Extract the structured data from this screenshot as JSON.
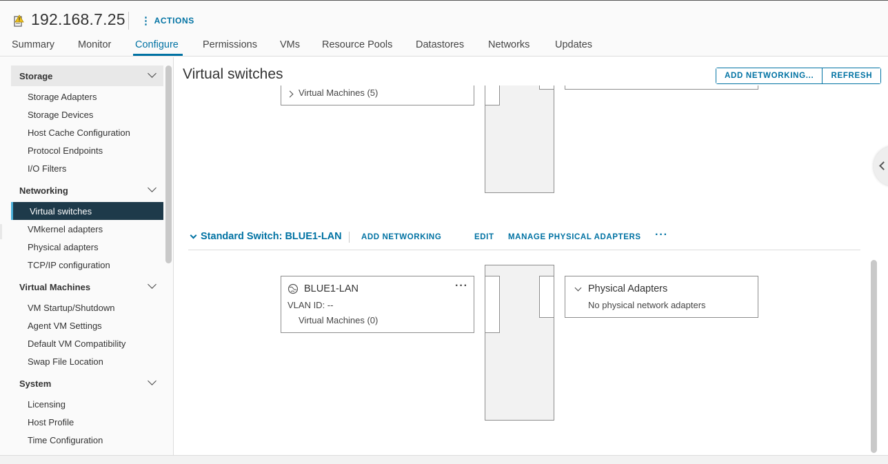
{
  "header": {
    "host_title": "192.168.7.25",
    "actions_label": "ACTIONS"
  },
  "tabs": [
    {
      "label": "Summary"
    },
    {
      "label": "Monitor"
    },
    {
      "label": "Configure",
      "active": true
    },
    {
      "label": "Permissions"
    },
    {
      "label": "VMs"
    },
    {
      "label": "Resource Pools"
    },
    {
      "label": "Datastores"
    },
    {
      "label": "Networks"
    },
    {
      "label": "Updates"
    }
  ],
  "sidebar": {
    "storage": {
      "title": "Storage",
      "items": [
        "Storage Adapters",
        "Storage Devices",
        "Host Cache Configuration",
        "Protocol Endpoints",
        "I/O Filters"
      ]
    },
    "networking": {
      "title": "Networking",
      "items": [
        "Virtual switches",
        "VMkernel adapters",
        "Physical adapters",
        "TCP/IP configuration"
      ],
      "selected": "Virtual switches"
    },
    "virtual_machines": {
      "title": "Virtual Machines",
      "items": [
        "VM Startup/Shutdown",
        "Agent VM Settings",
        "Default VM Compatibility",
        "Swap File Location"
      ]
    },
    "system": {
      "title": "System",
      "items": [
        "Licensing",
        "Host Profile",
        "Time Configuration"
      ]
    }
  },
  "main": {
    "title": "Virtual switches",
    "add_networking_btn": "ADD NETWORKING...",
    "refresh_btn": "REFRESH",
    "upper_switch": {
      "vm_row": "Virtual Machines (5)"
    },
    "switch": {
      "title": "Standard Switch: BLUE1-LAN",
      "add_networking": "ADD NETWORKING",
      "edit": "EDIT",
      "manage_adapters": "MANAGE PHYSICAL ADAPTERS",
      "more": "···",
      "port_group": {
        "name": "BLUE1-LAN",
        "vlan": "VLAN ID: --",
        "vms": "Virtual Machines (0)",
        "more": "···"
      },
      "physical": {
        "title": "Physical Adapters",
        "empty": "No physical network adapters"
      }
    }
  },
  "colors": {
    "accent": "#0072a3",
    "selected_nav_bg": "#1e3a4a",
    "selected_nav_bar": "#49afd9"
  }
}
